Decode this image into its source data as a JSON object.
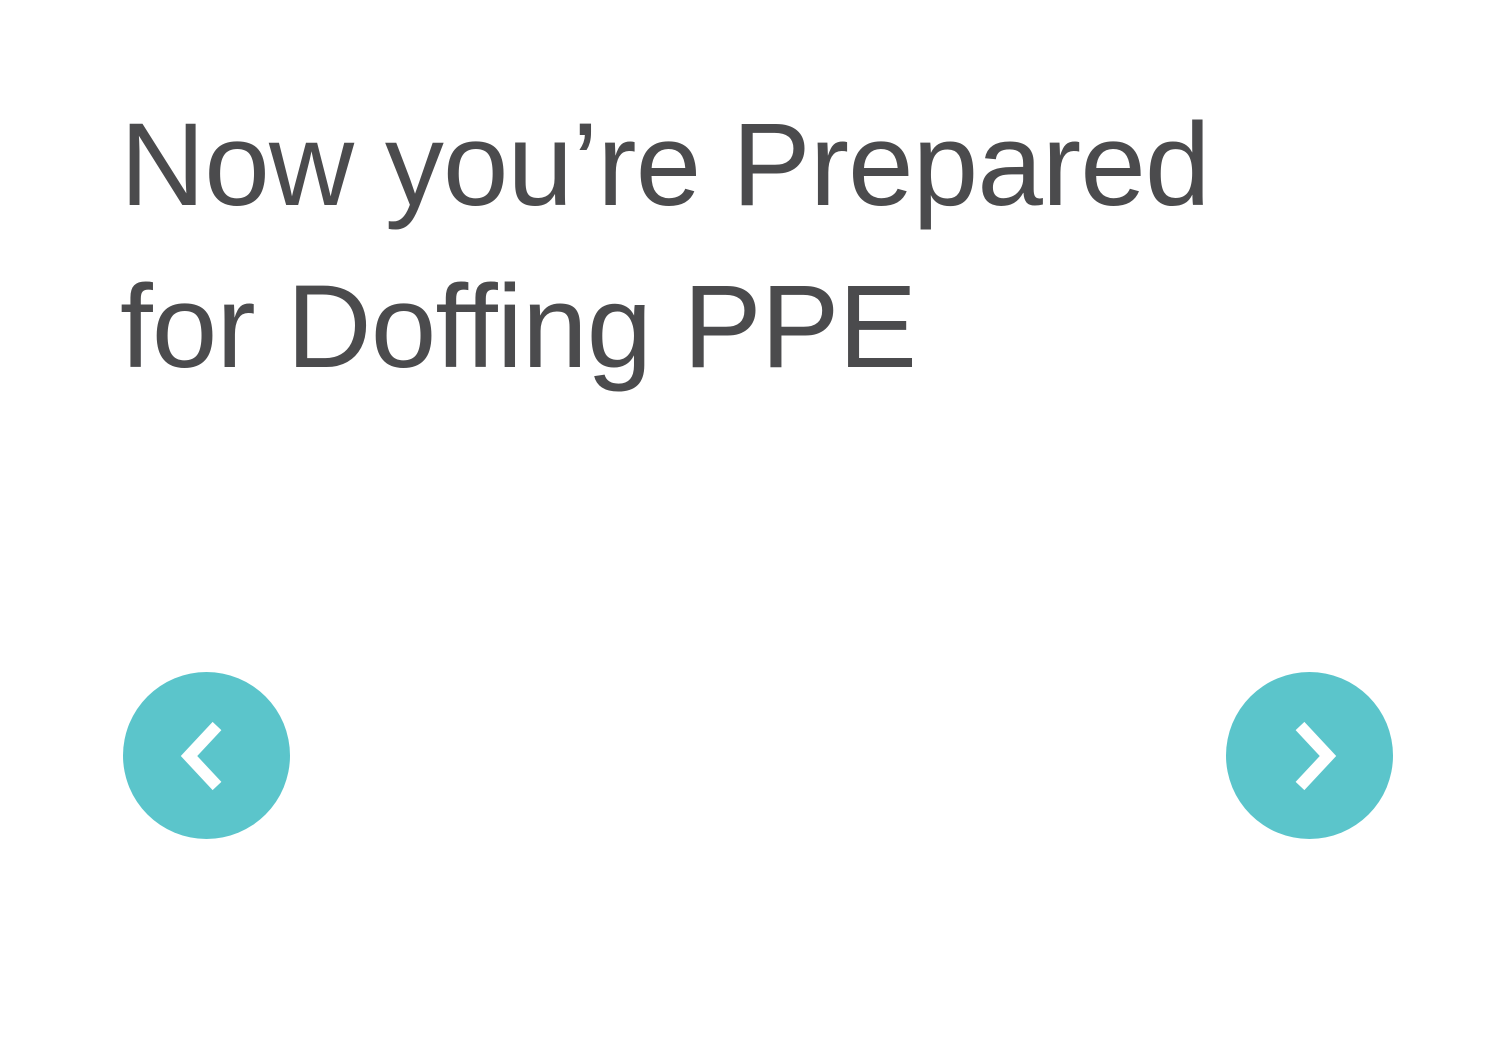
{
  "slide": {
    "title_line_1": "Now you’re Prepared",
    "title_line_2": "for Doffing PPE"
  },
  "navigation": {
    "prev_icon": "chevron-left-icon",
    "next_icon": "chevron-right-icon"
  },
  "colors": {
    "background": "#ffffff",
    "title_text": "#4b4b4d",
    "accent": "#5bc5cb",
    "icon": "#ffffff"
  }
}
